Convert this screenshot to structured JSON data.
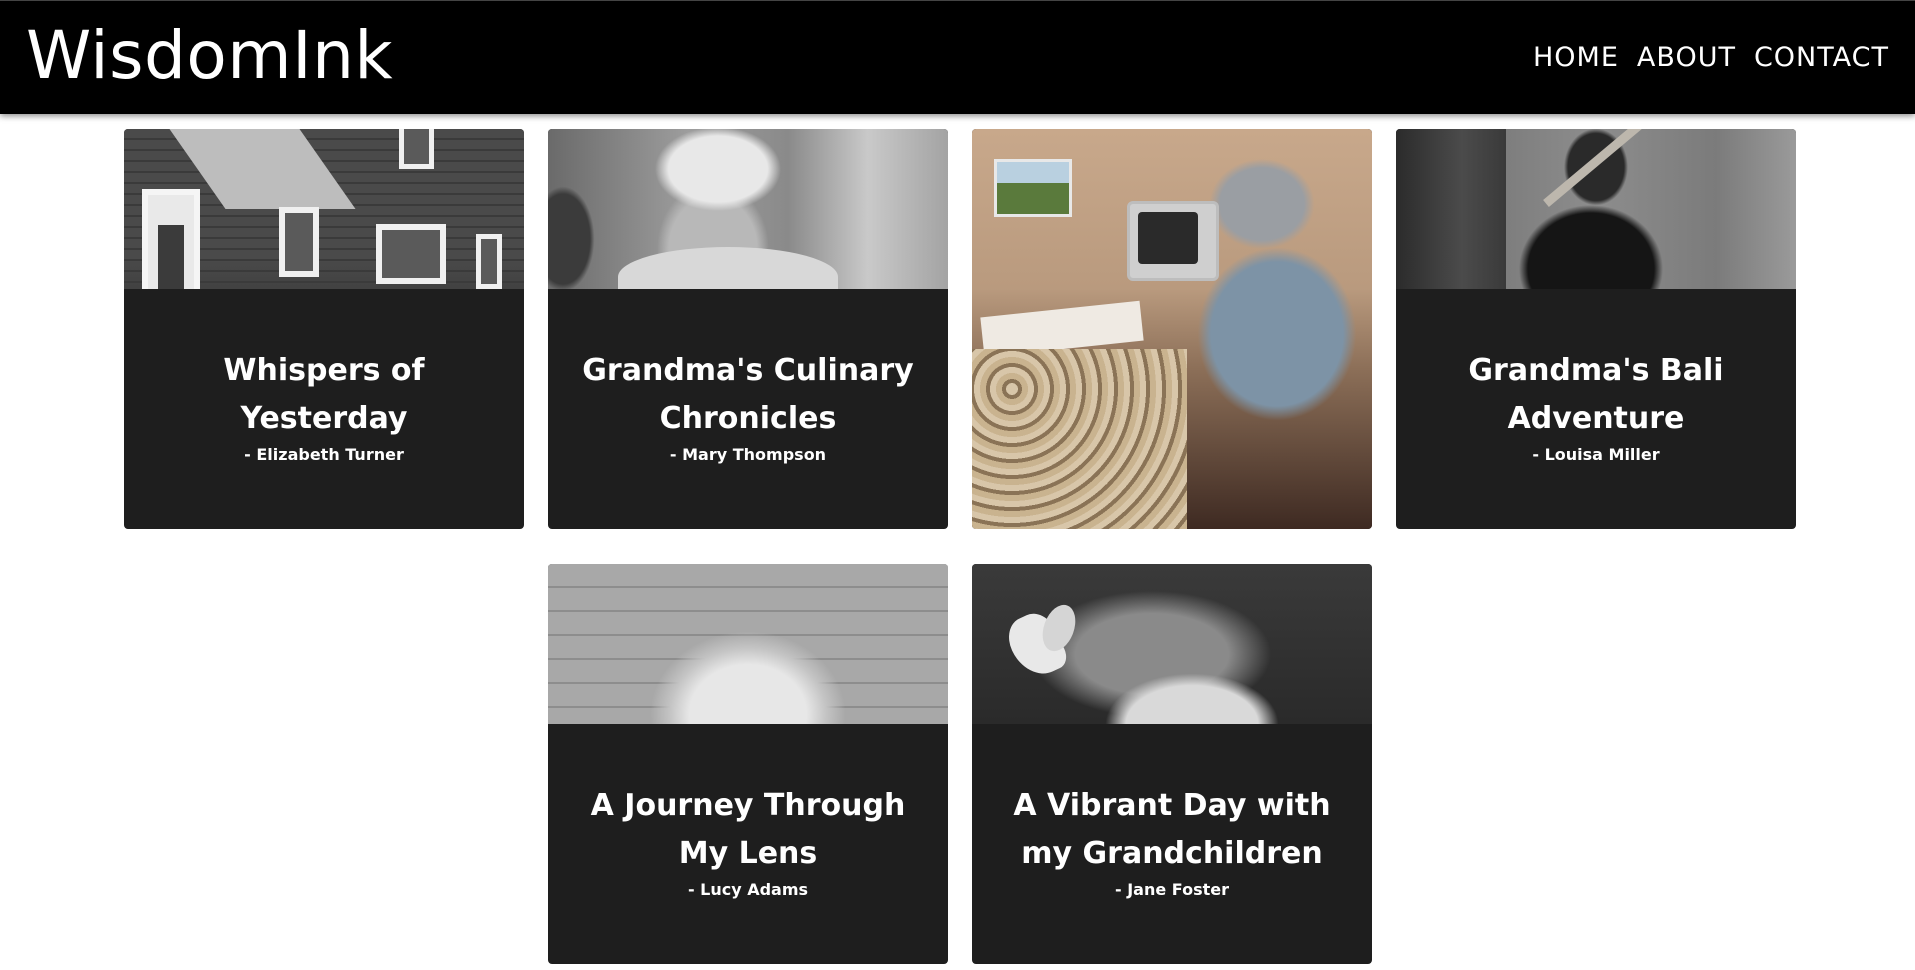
{
  "header": {
    "brand": "WisdomInk",
    "nav": [
      {
        "label": "HOME"
      },
      {
        "label": "ABOUT"
      },
      {
        "label": "CONTACT"
      }
    ]
  },
  "cards": [
    {
      "title": "Whispers of Yesterday",
      "author": "- Elizabeth Turner"
    },
    {
      "title": "Grandma's Culinary Chronicles",
      "author": "- Mary Thompson"
    },
    {
      "title": "",
      "author": ""
    },
    {
      "title": "Grandma's Bali Adventure",
      "author": "- Louisa Miller"
    },
    {
      "title": "A Journey Through My Lens",
      "author": "- Lucy Adams"
    },
    {
      "title": "A Vibrant Day with my Grandchildren",
      "author": "- Jane Foster"
    }
  ]
}
